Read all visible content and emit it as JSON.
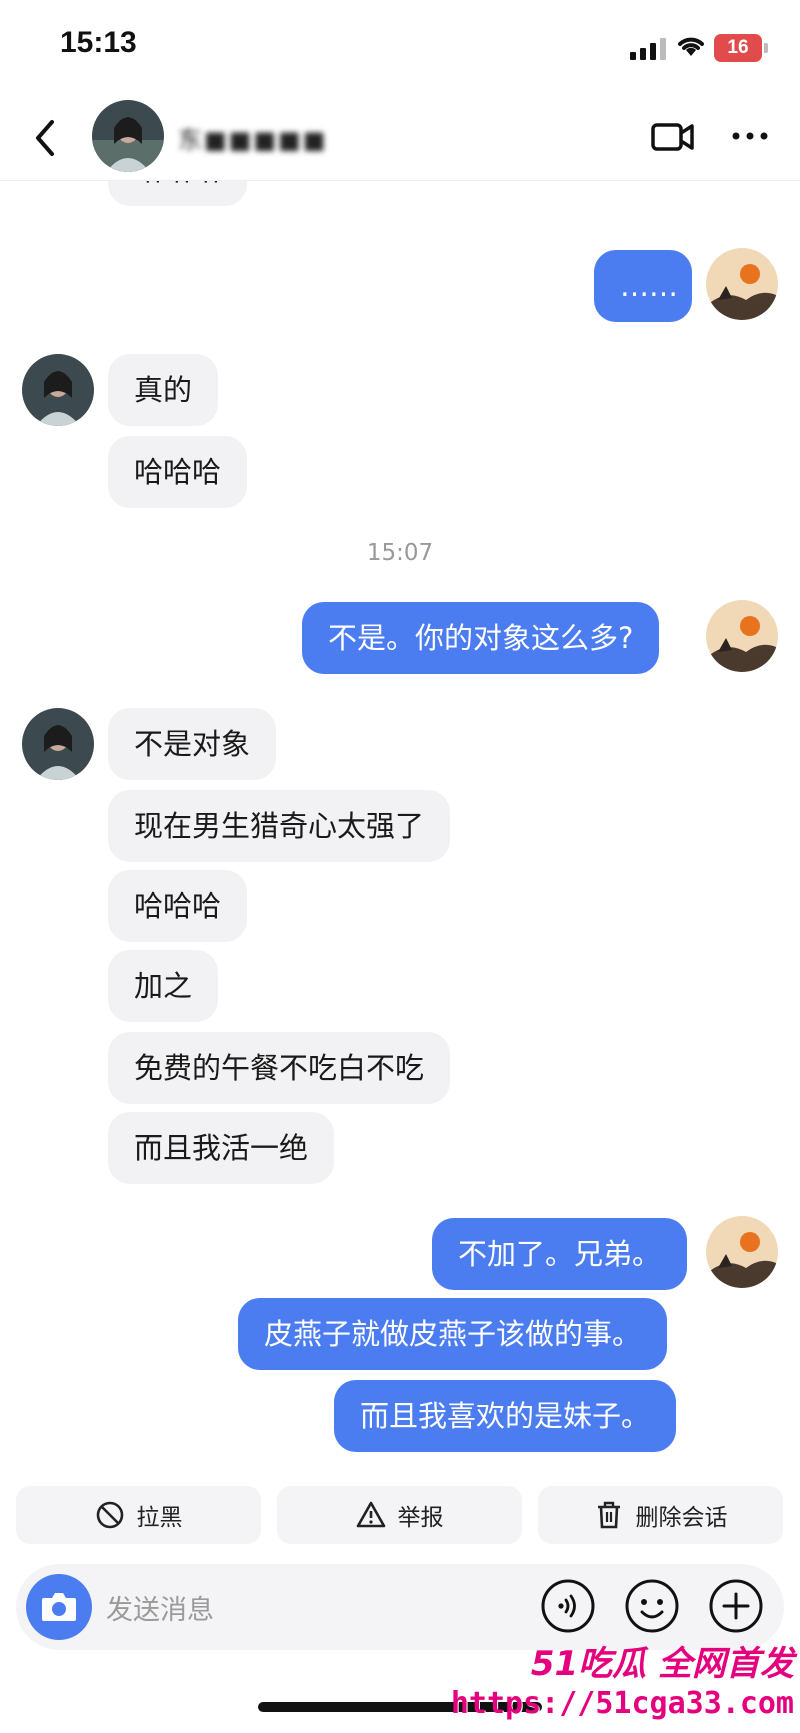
{
  "status_bar": {
    "time": "15:13",
    "battery": "16"
  },
  "header": {
    "contact_name": "东■■■■■",
    "video_icon": "video-camera-icon",
    "more_icon": "more-dots-icon"
  },
  "messages": {
    "m0": "哈哈哈",
    "m1": "……",
    "m2": "真的",
    "m3": "哈哈哈",
    "timestamp": "15:07",
    "m4": "不是。你的对象这么多?",
    "m5": "不是对象",
    "m6": "现在男生猎奇心太强了",
    "m7": "哈哈哈",
    "m8": "加之",
    "m9": "免费的午餐不吃白不吃",
    "m10": "而且我活一绝",
    "m11": "不加了。兄弟。",
    "m12": "皮燕子就做皮燕子该做的事。",
    "m13": "而且我喜欢的是妹子。"
  },
  "actions": {
    "block": "拉黑",
    "report": "举报",
    "delete": "删除会话"
  },
  "input": {
    "placeholder": "发送消息"
  },
  "watermark": {
    "line1": "51吃瓜 全网首发",
    "line2": "https://51cga33.com"
  },
  "colors": {
    "outgoing": "#4c7df0",
    "incoming": "#f2f2f4",
    "watermark": "#e5007e"
  }
}
